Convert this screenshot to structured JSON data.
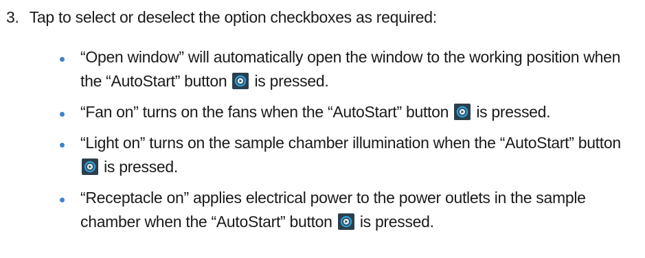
{
  "step": {
    "number": "3.",
    "text": "Tap to select or deselect the option checkboxes as required:"
  },
  "bullets": [
    {
      "before": "“Open window” will automatically open the window to the working position when the “AutoStart” button",
      "after": "is pressed."
    },
    {
      "before": "“Fan on” turns on the fans when the “AutoStart” button",
      "after": "is pressed."
    },
    {
      "before": "“Light on” turns on the sample chamber illumination when the “AutoStart” button",
      "after": "is pressed."
    },
    {
      "before": "“Receptacle on” applies electrical power to the power outlets in the sample chamber when the “AutoStart” button",
      "after": "is pressed."
    }
  ],
  "icons": {
    "autostart": "autostart-button-icon"
  },
  "colors": {
    "text": "#1a1a1a",
    "bullet": "#3f83c6",
    "icon_bg": "#2b3f4d",
    "icon_ring": "#2f9fd8"
  }
}
